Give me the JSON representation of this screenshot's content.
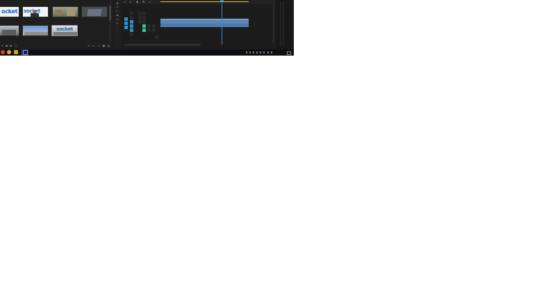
{
  "project_panel": {
    "items": [
      {
        "name": "",
        "logo_text": "ocket",
        "scene": "logo"
      },
      {
        "name": "",
        "logo_text": "socket",
        "scene": "person"
      },
      {
        "name": "",
        "logo_text": "",
        "scene": "outdoor"
      },
      {
        "name": "",
        "logo_text": "",
        "scene": "tablet"
      },
      {
        "name": "",
        "logo_text": "",
        "scene": "street"
      },
      {
        "name": "",
        "logo_text": "",
        "scene": "sky"
      },
      {
        "name": "",
        "logo_text": "socket",
        "scene": "building"
      }
    ]
  },
  "timeline": {
    "clip_label": "",
    "colors": {
      "clip": "#5b87b8",
      "playhead": "#2b8ad6",
      "marker": "#d8c43a",
      "active_toggle": "#2f8fd0",
      "record_toggle": "#37c98a"
    }
  },
  "taskbar": {
    "clock_time": "",
    "clock_date": ""
  }
}
